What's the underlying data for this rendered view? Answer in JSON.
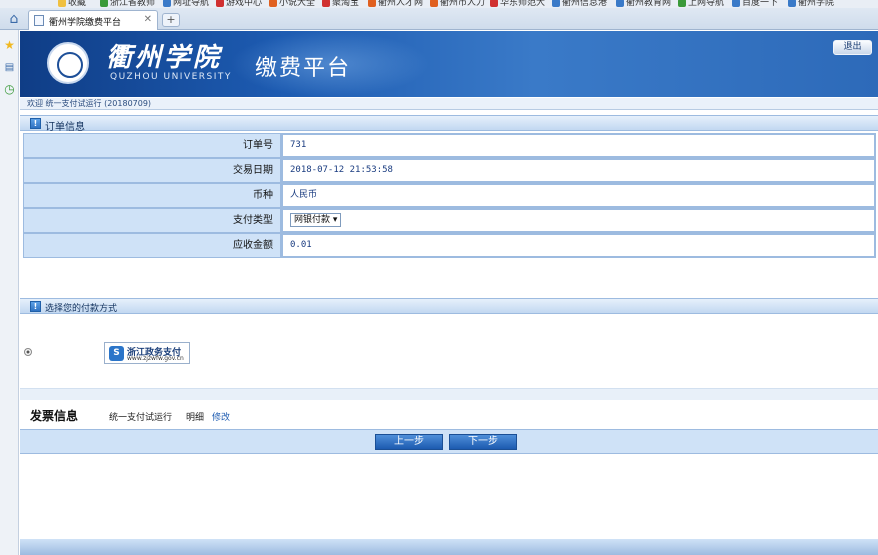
{
  "browser": {
    "bookmarks": [
      {
        "label": "收藏",
        "color": "#f0c040"
      },
      {
        "label": "浙江省教师",
        "color": "#3a9a3a"
      },
      {
        "label": "网址导航",
        "color": "#3a7ac8"
      },
      {
        "label": "游戏中心",
        "color": "#d03030"
      },
      {
        "label": "小说大全",
        "color": "#e06020"
      },
      {
        "label": "聚淘宝",
        "color": "#d03030"
      },
      {
        "label": "衢州人才网",
        "color": "#e06020"
      },
      {
        "label": "衢州市人力",
        "color": "#e06020"
      },
      {
        "label": "华东师范大",
        "color": "#d03030"
      },
      {
        "label": "衢州信息港",
        "color": "#3a7ac8"
      },
      {
        "label": "衢州教育网",
        "color": "#3a7ac8"
      },
      {
        "label": "上网导航",
        "color": "#3a9a3a"
      },
      {
        "label": "百度一下",
        "color": "#3a7ac8"
      },
      {
        "label": "衢州学院",
        "color": "#3a7ac8"
      }
    ],
    "tab_title": "衢州学院缴费平台",
    "tab_close": "✕",
    "new_tab": "+",
    "home_icon": "⌂"
  },
  "header": {
    "school_name_cn": "衢州学院",
    "school_name_en": "QUZHOU UNIVERSITY",
    "platform_title": "缴费平台",
    "logout_label": "退出"
  },
  "welcome_text": "欢迎 统一支付试运行 (20180709)",
  "order_section": {
    "title": "订单信息",
    "rows": [
      {
        "label": "订单号",
        "value": "731"
      },
      {
        "label": "交易日期",
        "value": "2018-07-12 21:53:58"
      },
      {
        "label": "币种",
        "value": "人民币"
      },
      {
        "label": "支付类型",
        "value": "网银付款 ▾"
      },
      {
        "label": "应收金额",
        "value": "0.01"
      }
    ]
  },
  "payment_section": {
    "title": "选择您的付款方式",
    "option": {
      "name": "浙江政务支付",
      "url": "www.zjzwfw.gov.cn",
      "selected": true
    }
  },
  "invoice": {
    "title": "发票信息",
    "text": "统一支付试运行",
    "detail_label": "明细",
    "edit_label": "修改"
  },
  "buttons": {
    "prev_label": "上一步",
    "next_label": "下一步"
  }
}
